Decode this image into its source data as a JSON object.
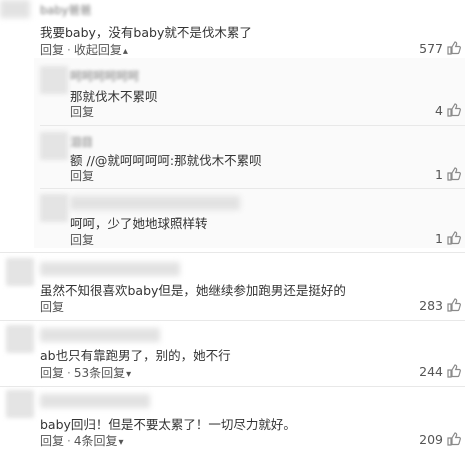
{
  "comments": [
    {
      "name": "baby爸爸",
      "text": "我要baby，没有baby就不是伐木累了",
      "actions": {
        "reply": "回复",
        "collapse": "收起回复",
        "chevron": "▴"
      },
      "likes": "577"
    },
    {
      "name": "呵呵呵呵呵呵",
      "text": "那就伐木不累呗",
      "actions": {
        "reply": "回复"
      },
      "likes": "4"
    },
    {
      "name": "泪目",
      "text": "额 //@就呵呵呵呵:那就伐木不累呗",
      "actions": {
        "reply": "回复"
      },
      "likes": "1"
    },
    {
      "name": "",
      "text": "呵呵，少了她地球照样转",
      "actions": {
        "reply": "回复"
      },
      "likes": "1"
    },
    {
      "name": "",
      "text": "虽然不知很喜欢baby但是，她继续参加跑男还是挺好的",
      "actions": {
        "reply": "回复"
      },
      "likes": "283"
    },
    {
      "name": "",
      "text": "ab也只有靠跑男了，别的，她不行",
      "actions": {
        "reply": "回复",
        "replies": "53条回复",
        "chevron": "▾"
      },
      "likes": "244"
    },
    {
      "name": "",
      "text": "baby回归！但是不要太累了！一切尽力就好。",
      "actions": {
        "reply": "回复",
        "replies": "4条回复",
        "chevron": "▾"
      },
      "likes": "209"
    }
  ],
  "icons": {
    "like": "thumbs-up-icon"
  },
  "colors": {
    "text": "#333333",
    "meta": "#555555",
    "divider": "#e8e8e8",
    "thumb": "#8a8a8a"
  }
}
